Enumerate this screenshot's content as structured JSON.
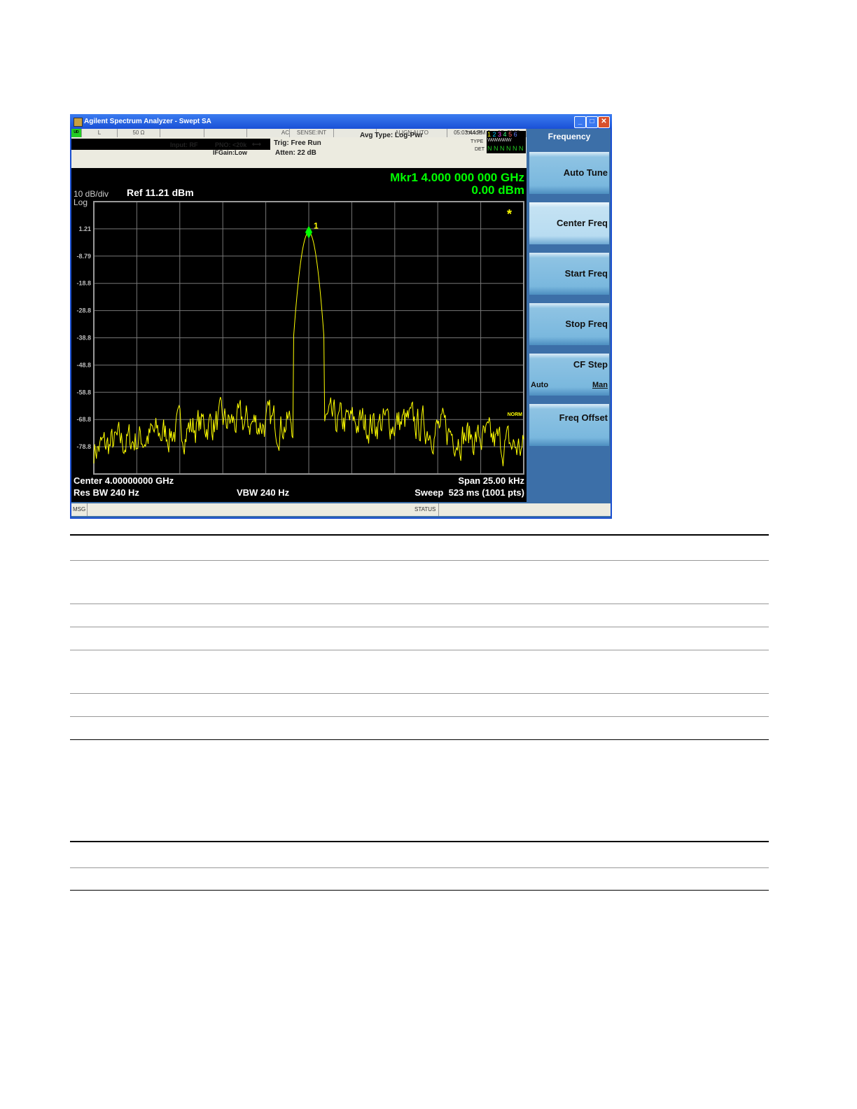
{
  "window": {
    "title": "Agilent Spectrum Analyzer - Swept SA"
  },
  "status_row": {
    "cells": [
      "L",
      "50 Ω",
      "",
      "",
      "AC",
      "SENSE:INT",
      "",
      "ALIGN AUTO",
      "05:03:44 PM Jan 18, 2007"
    ]
  },
  "settings": {
    "input": "Input: RF",
    "pno": "PNO: <20k",
    "ifgain": "IFGain:Low",
    "trig": "Trig: Free Run",
    "atten": "Atten: 22 dB",
    "avg_type": "Avg Type: Log-Pwr",
    "trace_label": "TRACE",
    "type_label": "TYPE",
    "det_label": "DET",
    "trace_numbers": [
      "1",
      "2",
      "3",
      "4",
      "5",
      "6"
    ],
    "trace_colors": [
      "#ffff00",
      "#00c8ff",
      "#ff40ff",
      "#40ff80",
      "#ff6060",
      "#6080ff"
    ],
    "type_value": "WWWWWW",
    "det_values": [
      "N",
      "N",
      "N",
      "N",
      "N",
      "N"
    ]
  },
  "marker": {
    "readout_freq": "Mkr1 4.000 000 000 GHz",
    "readout_amp": "0.00 dBm",
    "label": "1",
    "color": "#00ff00"
  },
  "scale": {
    "per_div": "10 dB/div",
    "ref": "Ref 11.21 dBm",
    "mode": "Log",
    "norm": "NORM",
    "star": "*"
  },
  "chart_data": {
    "type": "line",
    "ylabel": "",
    "y_ticks": [
      "1.21",
      "-8.79",
      "-18.8",
      "-28.8",
      "-38.8",
      "-48.8",
      "-58.8",
      "-68.8",
      "-78.8"
    ],
    "ylim": [
      -88.79,
      11.21
    ],
    "x_center_ghz": 4.0,
    "x_span_khz": 25.0,
    "grid": true,
    "trace_color": "#ffff00",
    "peak": {
      "x_ghz": 4.0,
      "y_dbm": 0.0
    },
    "noise_floor_dbm": -72
  },
  "footer": {
    "center": "Center 4.00000000 GHz",
    "span": "Span 25.00 kHz",
    "rbw": "Res BW 240 Hz",
    "vbw": "VBW 240 Hz",
    "sweep": "Sweep  523 ms (1001 pts)"
  },
  "softkeys": {
    "title": "Frequency",
    "items": [
      {
        "label": "Auto Tune"
      },
      {
        "label": "Center Freq"
      },
      {
        "label": "Start Freq"
      },
      {
        "label": "Stop Freq"
      },
      {
        "label": "CF Step",
        "auto": "Auto",
        "man": "Man"
      },
      {
        "label": "Freq Offset"
      }
    ]
  },
  "msgbar": {
    "msg": "MSG",
    "status": "STATUS"
  }
}
